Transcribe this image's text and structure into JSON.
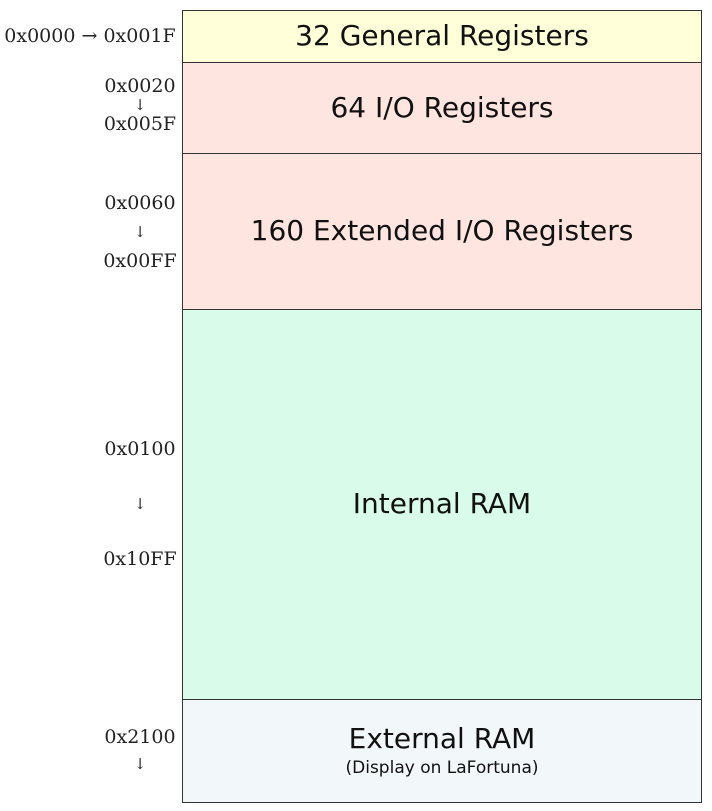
{
  "memory_map": {
    "blocks": [
      {
        "label": "32 General Registers",
        "addr_range": "0x0000 → 0x001F",
        "color": "#ffffd9"
      },
      {
        "label": "64 I/O Registers",
        "addr_start": "0x0020",
        "arrow": "↓",
        "addr_end": "0x005F",
        "color": "#ffe5e0"
      },
      {
        "label": "160 Extended I/O Registers",
        "addr_start": "0x0060",
        "arrow": "↓",
        "addr_end": "0x00FF",
        "color": "#ffe5e0"
      },
      {
        "label": "Internal RAM",
        "addr_start": "0x0100",
        "arrow": "↓",
        "addr_end": "0x10FF",
        "color": "#d9fbe9"
      },
      {
        "label": "External RAM",
        "sublabel": "(Display on LaFortuna)",
        "addr_start": "0x2100",
        "arrow": "↓",
        "color": "#f2f7fa"
      }
    ]
  }
}
